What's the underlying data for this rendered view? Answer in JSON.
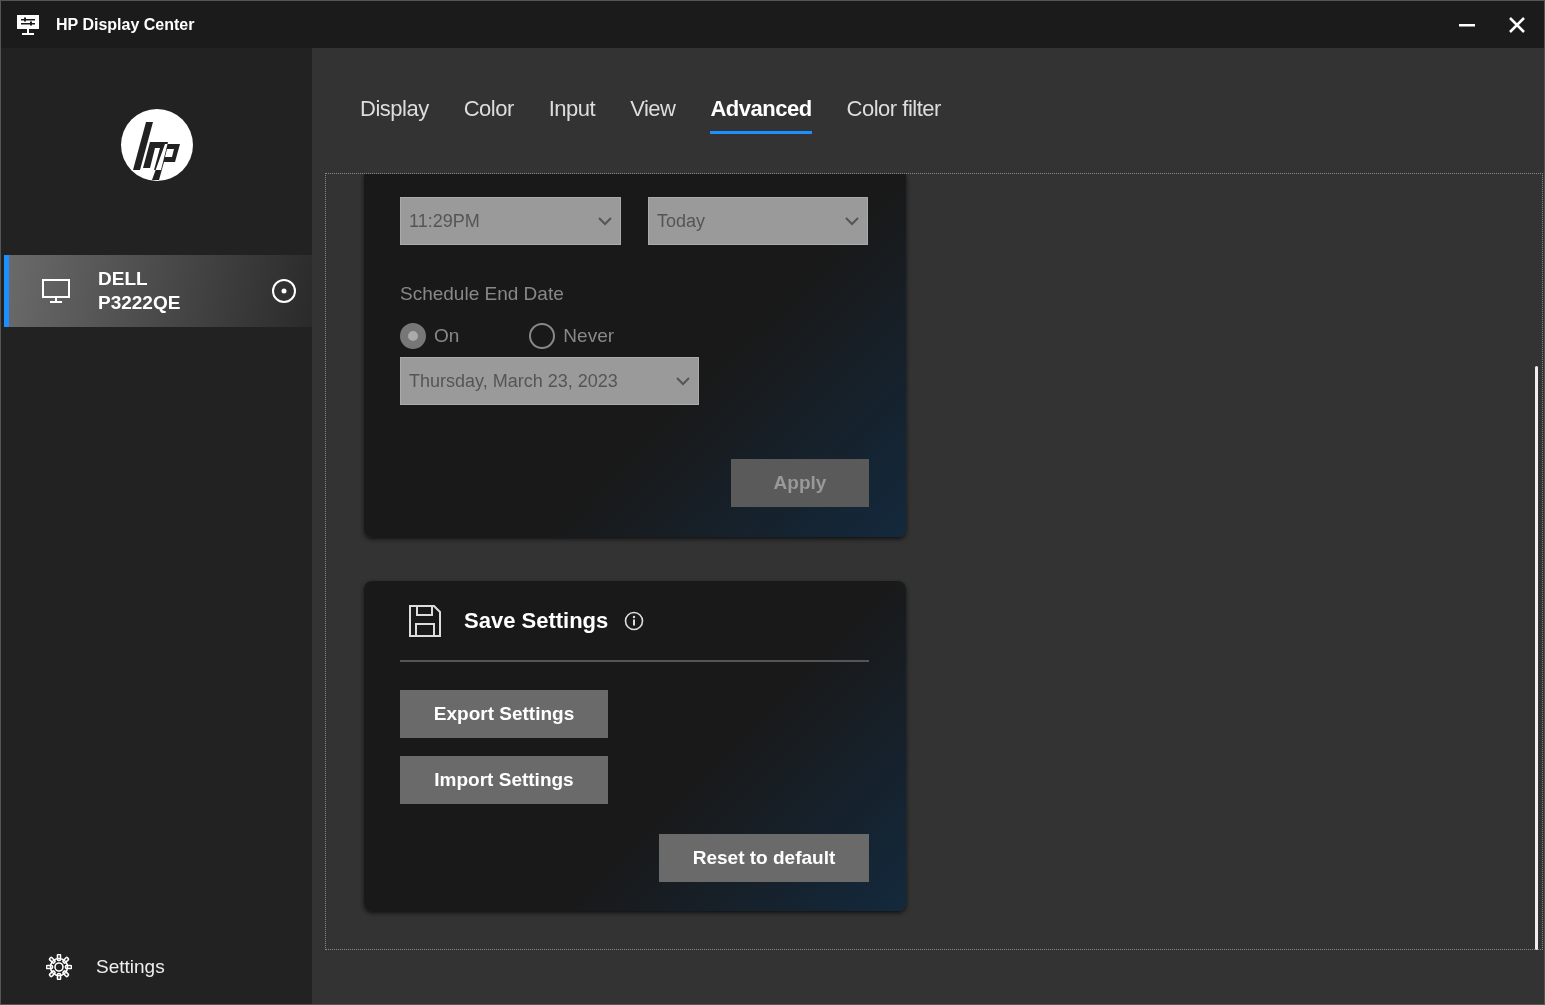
{
  "window": {
    "title": "HP Display Center"
  },
  "sidebar": {
    "devices": [
      {
        "name": "DELL P3222QE",
        "selected": true
      }
    ],
    "settings_label": "Settings"
  },
  "tabs": [
    {
      "label": "Display",
      "selected": false
    },
    {
      "label": "Color",
      "selected": false
    },
    {
      "label": "Input",
      "selected": false
    },
    {
      "label": "View",
      "selected": false
    },
    {
      "label": "Advanced",
      "selected": true
    },
    {
      "label": "Color filter",
      "selected": false
    }
  ],
  "schedule": {
    "disabled": true,
    "start_time": "11:29PM",
    "occurs": "Today",
    "end_date_label": "Schedule End Date",
    "end_options": [
      {
        "label": "On",
        "selected": true
      },
      {
        "label": "Never",
        "selected": false
      }
    ],
    "end_date": "Thursday, March 23, 2023",
    "apply_button": "Apply"
  },
  "save_settings": {
    "title": "Save Settings",
    "buttons": [
      "Export Settings",
      "Import Settings"
    ],
    "reset_button": "Reset to default"
  }
}
